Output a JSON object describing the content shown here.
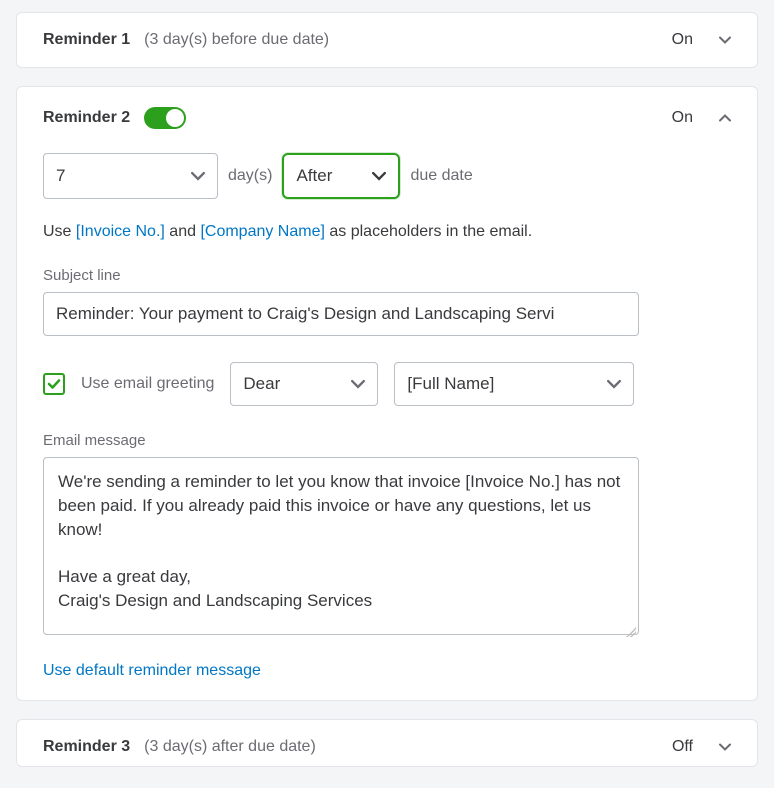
{
  "reminder1": {
    "title": "Reminder 1",
    "sub": "(3 day(s) before due date)",
    "state": "On"
  },
  "reminder2": {
    "title": "Reminder 2",
    "state": "On",
    "days_value": "7",
    "days_label": "day(s)",
    "timing_value": "After",
    "due_label": "due date",
    "hint_use": "Use ",
    "hint_ph1": "[Invoice No.]",
    "hint_and": " and ",
    "hint_ph2": "[Company Name]",
    "hint_tail": " as placeholders in the email.",
    "subject_label": "Subject line",
    "subject_value": "Reminder: Your payment to Craig's Design and Landscaping Servi",
    "greeting_checkbox_label": "Use email greeting",
    "greeting_salutation": "Dear",
    "greeting_name": "[Full Name]",
    "message_label": "Email message",
    "message_value": "We're sending a reminder to let you know that invoice [Invoice No.] has not been paid. If you already paid this invoice or have any questions, let us know!\n\nHave a great day,\nCraig's Design and Landscaping Services",
    "default_link": "Use default reminder message"
  },
  "reminder3": {
    "title": "Reminder 3",
    "sub": "(3 day(s) after due date)",
    "state": "Off"
  }
}
